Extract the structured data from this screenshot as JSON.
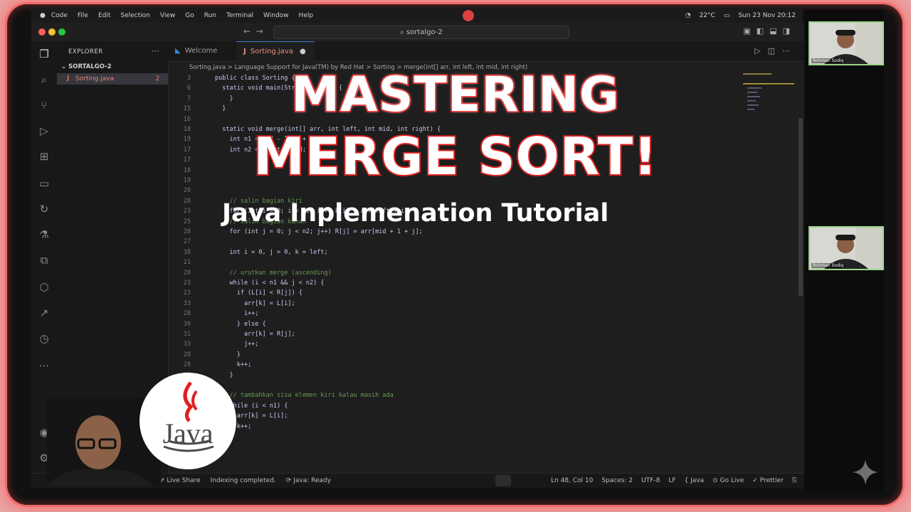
{
  "menubar": {
    "items": [
      "Code",
      "File",
      "Edit",
      "Selection",
      "View",
      "Go",
      "Run",
      "Terminal",
      "Window",
      "Help"
    ],
    "status_right": [
      "22°C",
      "Sun 23 Nov 20:12"
    ]
  },
  "titlebar": {
    "search": "sortalgo-2"
  },
  "sidebar": {
    "title": "EXPLORER",
    "folder": "SORTALGO-2",
    "file": "Sorting.java",
    "file_badge": "2"
  },
  "tabs": [
    {
      "label": "Welcome"
    },
    {
      "label": "Sorting.java"
    }
  ],
  "breadcrumb": "Sorting.java > Language Support for Java(TM) by Red Hat > Sorting > merge(int[] arr, int left, int mid, int right)",
  "code_lines": [
    {
      "n": "3",
      "t": "public class Sorting {",
      "c": false
    },
    {
      "n": "6",
      "t": "  static void main(String[] args) {",
      "c": false
    },
    {
      "n": "7",
      "t": "    }",
      "c": false
    },
    {
      "n": "15",
      "t": "  }",
      "c": false
    },
    {
      "n": "16",
      "t": "",
      "c": false
    },
    {
      "n": "18",
      "t": "  static void merge(int[] arr, int left, int mid, int right) {",
      "c": false
    },
    {
      "n": "19",
      "t": "    int n1 = mid - left + 1;",
      "c": false
    },
    {
      "n": "17",
      "t": "    int n2 = right - mid;",
      "c": false
    },
    {
      "n": "17",
      "t": "",
      "c": false
    },
    {
      "n": "18",
      "t": "",
      "c": false
    },
    {
      "n": "19",
      "t": "",
      "c": false
    },
    {
      "n": "20",
      "t": "",
      "c": false
    },
    {
      "n": "28",
      "t": "    // salin bagian kiri",
      "c": true
    },
    {
      "n": "23",
      "t": "    for (int i = 0; i < n1; i++) L[i] = arr[left + i];",
      "c": false
    },
    {
      "n": "25",
      "t": "    // salin bagian kanan",
      "c": true
    },
    {
      "n": "28",
      "t": "    for (int j = 0; j < n2; j++) R[j] = arr[mid + 1 + j];",
      "c": false
    },
    {
      "n": "27",
      "t": "",
      "c": false
    },
    {
      "n": "38",
      "t": "    int i = 0, j = 0, k = left;",
      "c": false
    },
    {
      "n": "21",
      "t": "",
      "c": false
    },
    {
      "n": "20",
      "t": "    // urutkan merge (ascending)",
      "c": true
    },
    {
      "n": "23",
      "t": "    while (i < n1 && j < n2) {",
      "c": false
    },
    {
      "n": "23",
      "t": "      if (L[i] < R[j]) {",
      "c": false
    },
    {
      "n": "33",
      "t": "        arr[k] = L[i];",
      "c": false
    },
    {
      "n": "28",
      "t": "        i++;",
      "c": false
    },
    {
      "n": "30",
      "t": "      } else {",
      "c": false
    },
    {
      "n": "31",
      "t": "        arr[k] = R[j];",
      "c": false
    },
    {
      "n": "33",
      "t": "        j++;",
      "c": false
    },
    {
      "n": "28",
      "t": "      }",
      "c": false
    },
    {
      "n": "28",
      "t": "      k++;",
      "c": false
    },
    {
      "n": "23",
      "t": "    }",
      "c": false
    },
    {
      "n": "28",
      "t": "",
      "c": false
    },
    {
      "n": "28",
      "t": "    // tambahkan sisa elemen kiri kalau masih ada",
      "c": true
    },
    {
      "n": "28",
      "t": "    while (i < n1) {",
      "c": false
    },
    {
      "n": "28",
      "t": "      arr[k] = L[i];",
      "c": false
    },
    {
      "n": "28",
      "t": "      k++;",
      "c": false
    }
  ],
  "statusbar": {
    "live_share": "Live Share",
    "indexing": "Indexing completed.",
    "java_ready": "Java: Ready",
    "position": "Ln 48, Col 10",
    "spaces": "Spaces: 2",
    "encoding": "UTF-8",
    "eol": "LF",
    "language": "Java",
    "go_live": "Go Live",
    "prettier": "Prettier"
  },
  "overlay": {
    "line1": "MASTERING",
    "line2": "MERGE SORT!",
    "subtitle": "Java Inplemenation Tutorial"
  },
  "java_logo_text": "Java",
  "participants": [
    {
      "name": "Rohman Sodiq"
    },
    {
      "name": "Rohman Sodiq"
    }
  ],
  "colors": {
    "title_stroke": "#e02222",
    "frame_glow": "#f06a6a",
    "camera_border": "#9bd48a"
  }
}
